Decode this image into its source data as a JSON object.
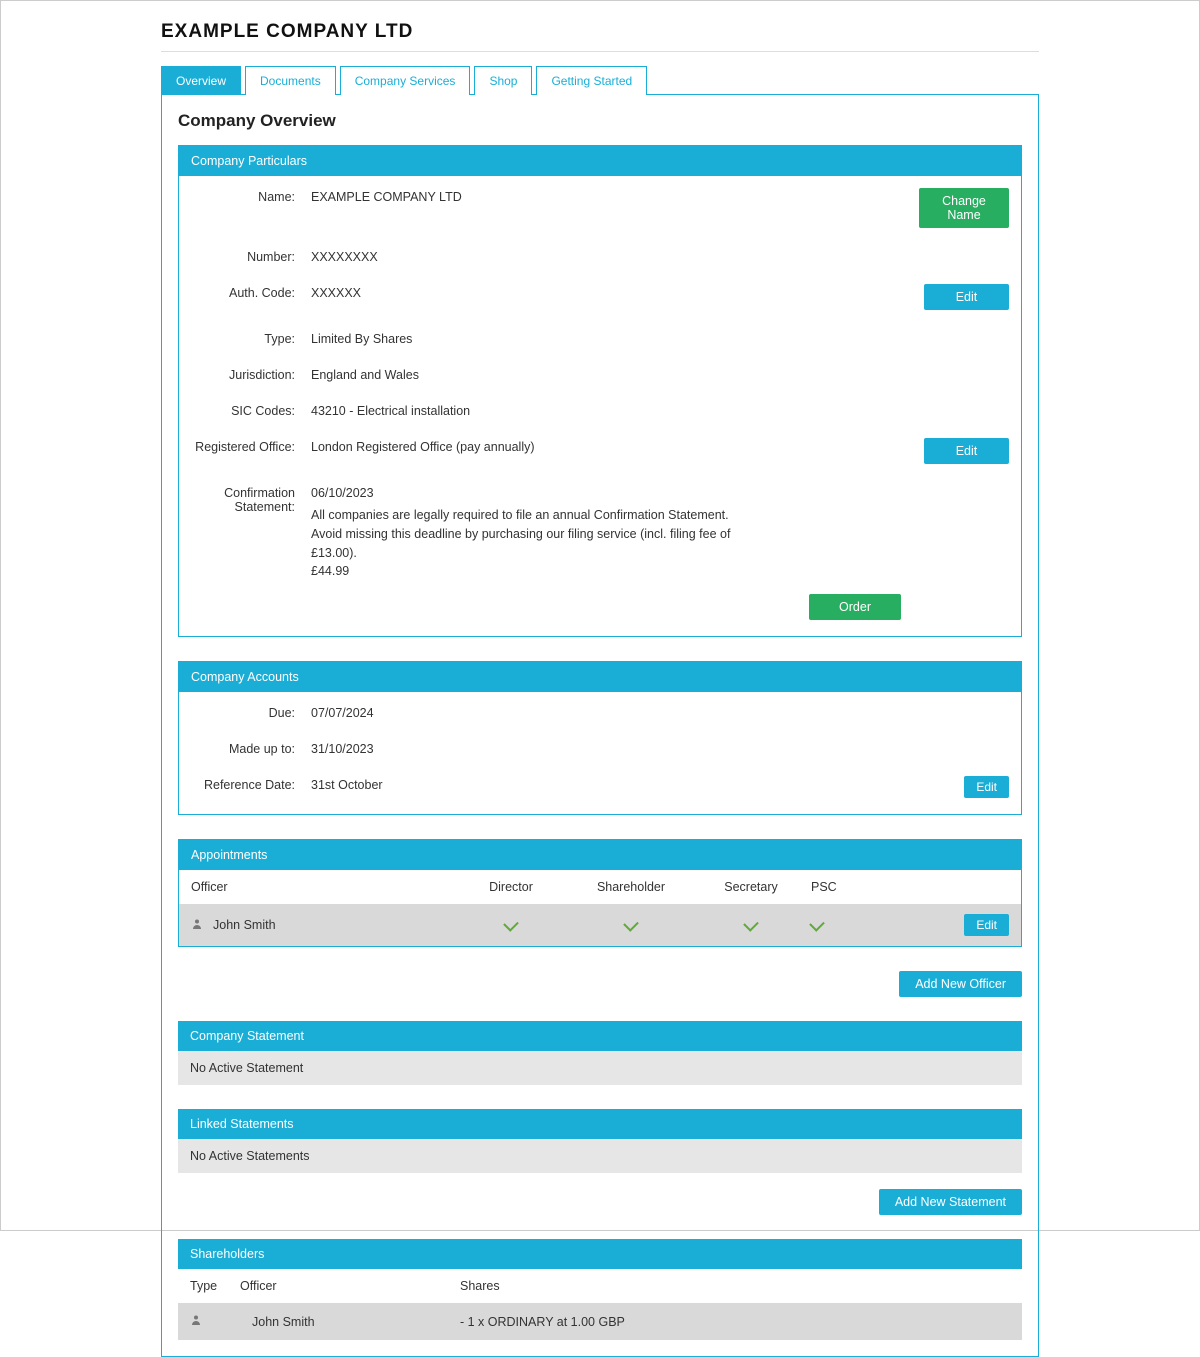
{
  "header": {
    "company_title": "EXAMPLE COMPANY LTD"
  },
  "tabs": {
    "overview": "Overview",
    "documents": "Documents",
    "services": "Company Services",
    "shop": "Shop",
    "getting_started": "Getting Started"
  },
  "page_title": "Company Overview",
  "particulars": {
    "header": "Company Particulars",
    "name_label": "Name:",
    "name_value": "EXAMPLE COMPANY LTD",
    "change_name_btn": "Change Name",
    "number_label": "Number:",
    "number_value": "XXXXXXXX",
    "auth_label": "Auth. Code:",
    "auth_value": "XXXXXX",
    "auth_edit": "Edit",
    "type_label": "Type:",
    "type_value": "Limited By Shares",
    "jurisdiction_label": "Jurisdiction:",
    "jurisdiction_value": "England and Wales",
    "sic_label": "SIC Codes:",
    "sic_value": "43210 - Electrical installation",
    "ro_label": "Registered Office:",
    "ro_value": "London Registered Office (pay annually)",
    "ro_edit": "Edit",
    "cs_label": "Confirmation Statement:",
    "cs_date": "06/10/2023",
    "cs_note": "All companies are legally required to file an annual Confirmation Statement. Avoid missing this deadline by purchasing our filing service (incl. filing fee of £13.00).",
    "cs_price": "£44.99",
    "order_btn": "Order"
  },
  "accounts": {
    "header": "Company Accounts",
    "due_label": "Due:",
    "due_value": "07/07/2024",
    "madeup_label": "Made up to:",
    "madeup_value": "31/10/2023",
    "ref_label": "Reference Date:",
    "ref_value": "31st October",
    "edit_btn": "Edit"
  },
  "appointments": {
    "header": "Appointments",
    "col_officer": "Officer",
    "col_director": "Director",
    "col_shareholder": "Shareholder",
    "col_secretary": "Secretary",
    "col_psc": "PSC",
    "officer_name": "John Smith",
    "edit_btn": "Edit",
    "add_btn": "Add New Officer"
  },
  "company_statement": {
    "header": "Company Statement",
    "body": "No Active Statement"
  },
  "linked_statements": {
    "header": "Linked Statements",
    "body": "No Active Statements",
    "add_btn": "Add New Statement"
  },
  "shareholders": {
    "header": "Shareholders",
    "col_type": "Type",
    "col_officer": "Officer",
    "col_shares": "Shares",
    "officer_name": "John Smith",
    "shares_text": "- 1 x ORDINARY at 1.00 GBP"
  }
}
